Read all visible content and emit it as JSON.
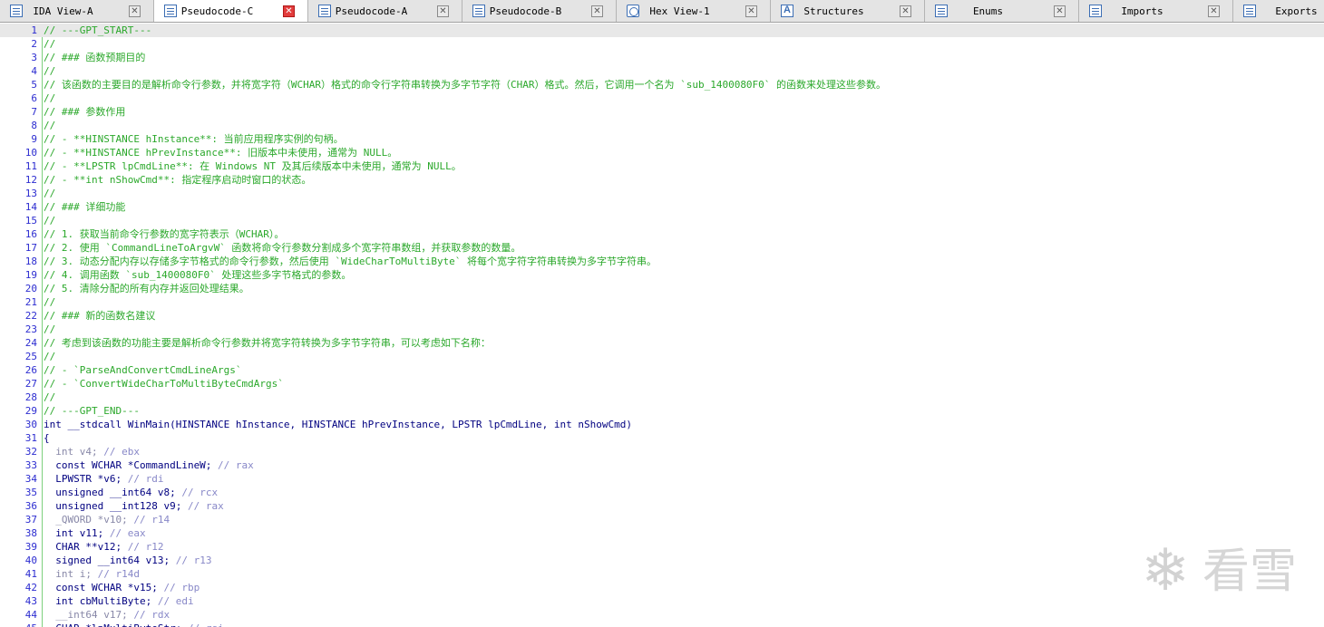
{
  "tabs": [
    {
      "label": "IDA View-A",
      "icon": "disassembly-view-icon",
      "active": false
    },
    {
      "label": "Pseudocode-C",
      "icon": "pseudocode-icon",
      "active": true
    },
    {
      "label": "Pseudocode-A",
      "icon": "pseudocode-icon",
      "active": false
    },
    {
      "label": "Pseudocode-B",
      "icon": "pseudocode-icon",
      "active": false
    },
    {
      "label": "Hex View-1",
      "icon": "hex-view-icon",
      "active": false
    },
    {
      "label": "Structures",
      "icon": "structures-icon",
      "active": false
    },
    {
      "label": "Enums",
      "icon": "enums-icon",
      "active": false
    },
    {
      "label": "Imports",
      "icon": "imports-icon",
      "active": false
    },
    {
      "label": "Exports",
      "icon": "exports-icon",
      "active": false
    }
  ],
  "tab_close_glyph": "✕",
  "colors": {
    "comment": "#2ba82b",
    "code": "#000080",
    "register_comment": "#8888c8",
    "line_number": "#2c2cd0",
    "current_line_bg": "#e8e8e8"
  },
  "code_lines": [
    {
      "n": "1",
      "kind": "comment",
      "text": "// ---GPT_START---"
    },
    {
      "n": "2",
      "kind": "comment",
      "text": "//"
    },
    {
      "n": "3",
      "kind": "comment",
      "text": "// ### 函数预期目的"
    },
    {
      "n": "4",
      "kind": "comment",
      "text": "//"
    },
    {
      "n": "5",
      "kind": "comment",
      "text": "// 该函数的主要目的是解析命令行参数，并将宽字符（WCHAR）格式的命令行字符串转换为多字节字符（CHAR）格式。然后，它调用一个名为 `sub_1400080F0` 的函数来处理这些参数。"
    },
    {
      "n": "6",
      "kind": "comment",
      "text": "//"
    },
    {
      "n": "7",
      "kind": "comment",
      "text": "// ### 参数作用"
    },
    {
      "n": "8",
      "kind": "comment",
      "text": "//"
    },
    {
      "n": "9",
      "kind": "comment",
      "text": "// - **HINSTANCE hInstance**: 当前应用程序实例的句柄。"
    },
    {
      "n": "10",
      "kind": "comment",
      "text": "// - **HINSTANCE hPrevInstance**: 旧版本中未使用，通常为 NULL。"
    },
    {
      "n": "11",
      "kind": "comment",
      "text": "// - **LPSTR lpCmdLine**: 在 Windows NT 及其后续版本中未使用，通常为 NULL。"
    },
    {
      "n": "12",
      "kind": "comment",
      "text": "// - **int nShowCmd**: 指定程序启动时窗口的状态。"
    },
    {
      "n": "13",
      "kind": "comment",
      "text": "//"
    },
    {
      "n": "14",
      "kind": "comment",
      "text": "// ### 详细功能"
    },
    {
      "n": "15",
      "kind": "comment",
      "text": "//"
    },
    {
      "n": "16",
      "kind": "comment",
      "text": "// 1. 获取当前命令行参数的宽字符表示（WCHAR）。"
    },
    {
      "n": "17",
      "kind": "comment",
      "text": "// 2. 使用 `CommandLineToArgvW` 函数将命令行参数分割成多个宽字符串数组，并获取参数的数量。"
    },
    {
      "n": "18",
      "kind": "comment",
      "text": "// 3. 动态分配内存以存储多字节格式的命令行参数，然后使用 `WideCharToMultiByte` 将每个宽字符字符串转换为多字节字符串。"
    },
    {
      "n": "19",
      "kind": "comment",
      "text": "// 4. 调用函数 `sub_1400080F0` 处理这些多字节格式的参数。"
    },
    {
      "n": "20",
      "kind": "comment",
      "text": "// 5. 清除分配的所有内存并返回处理结果。"
    },
    {
      "n": "21",
      "kind": "comment",
      "text": "//"
    },
    {
      "n": "22",
      "kind": "comment",
      "text": "// ### 新的函数名建议"
    },
    {
      "n": "23",
      "kind": "comment",
      "text": "//"
    },
    {
      "n": "24",
      "kind": "comment",
      "text": "// 考虑到该函数的功能主要是解析命令行参数并将宽字符转换为多字节字符串，可以考虑如下名称："
    },
    {
      "n": "25",
      "kind": "comment",
      "text": "//"
    },
    {
      "n": "26",
      "kind": "comment",
      "text": "// - `ParseAndConvertCmdLineArgs`"
    },
    {
      "n": "27",
      "kind": "comment",
      "text": "// - `ConvertWideCharToMultiByteCmdArgs`"
    },
    {
      "n": "28",
      "kind": "comment",
      "text": "//"
    },
    {
      "n": "29",
      "kind": "comment",
      "text": "// ---GPT_END---"
    },
    {
      "n": "30",
      "kind": "code",
      "text": "int __stdcall WinMain(HINSTANCE hInstance, HINSTANCE hPrevInstance, LPSTR lpCmdLine, int nShowCmd)"
    },
    {
      "n": "31",
      "kind": "code",
      "text": "{"
    },
    {
      "n": "32",
      "kind": "decl",
      "text": "  int v4;",
      "cmt": " // ebx",
      "dim": true
    },
    {
      "n": "33",
      "kind": "decl",
      "text": "  const WCHAR *CommandLineW;",
      "cmt": " // rax"
    },
    {
      "n": "34",
      "kind": "decl",
      "text": "  LPWSTR *v6;",
      "cmt": " // rdi"
    },
    {
      "n": "35",
      "kind": "decl",
      "text": "  unsigned __int64 v8;",
      "cmt": " // rcx"
    },
    {
      "n": "36",
      "kind": "decl",
      "text": "  unsigned __int128 v9;",
      "cmt": " // rax"
    },
    {
      "n": "37",
      "kind": "decl",
      "text": "  _QWORD *v10;",
      "cmt": " // r14",
      "dim": true
    },
    {
      "n": "38",
      "kind": "decl",
      "text": "  int v11;",
      "cmt": " // eax"
    },
    {
      "n": "39",
      "kind": "decl",
      "text": "  CHAR **v12;",
      "cmt": " // r12"
    },
    {
      "n": "40",
      "kind": "decl",
      "text": "  signed __int64 v13;",
      "cmt": " // r13"
    },
    {
      "n": "41",
      "kind": "decl",
      "text": "  int i;",
      "cmt": " // r14d",
      "dim": true
    },
    {
      "n": "42",
      "kind": "decl",
      "text": "  const WCHAR *v15;",
      "cmt": " // rbp"
    },
    {
      "n": "43",
      "kind": "decl",
      "text": "  int cbMultiByte;",
      "cmt": " // edi"
    },
    {
      "n": "44",
      "kind": "decl",
      "text": "  __int64 v17;",
      "cmt": " // rdx",
      "dim": true
    },
    {
      "n": "45",
      "kind": "decl",
      "text": "  CHAR *lpMultiByteStr;",
      "cmt": " // rsi"
    }
  ],
  "current_line": "1",
  "watermark": {
    "icon": "snowflake-logo-icon",
    "text": "看雪"
  }
}
